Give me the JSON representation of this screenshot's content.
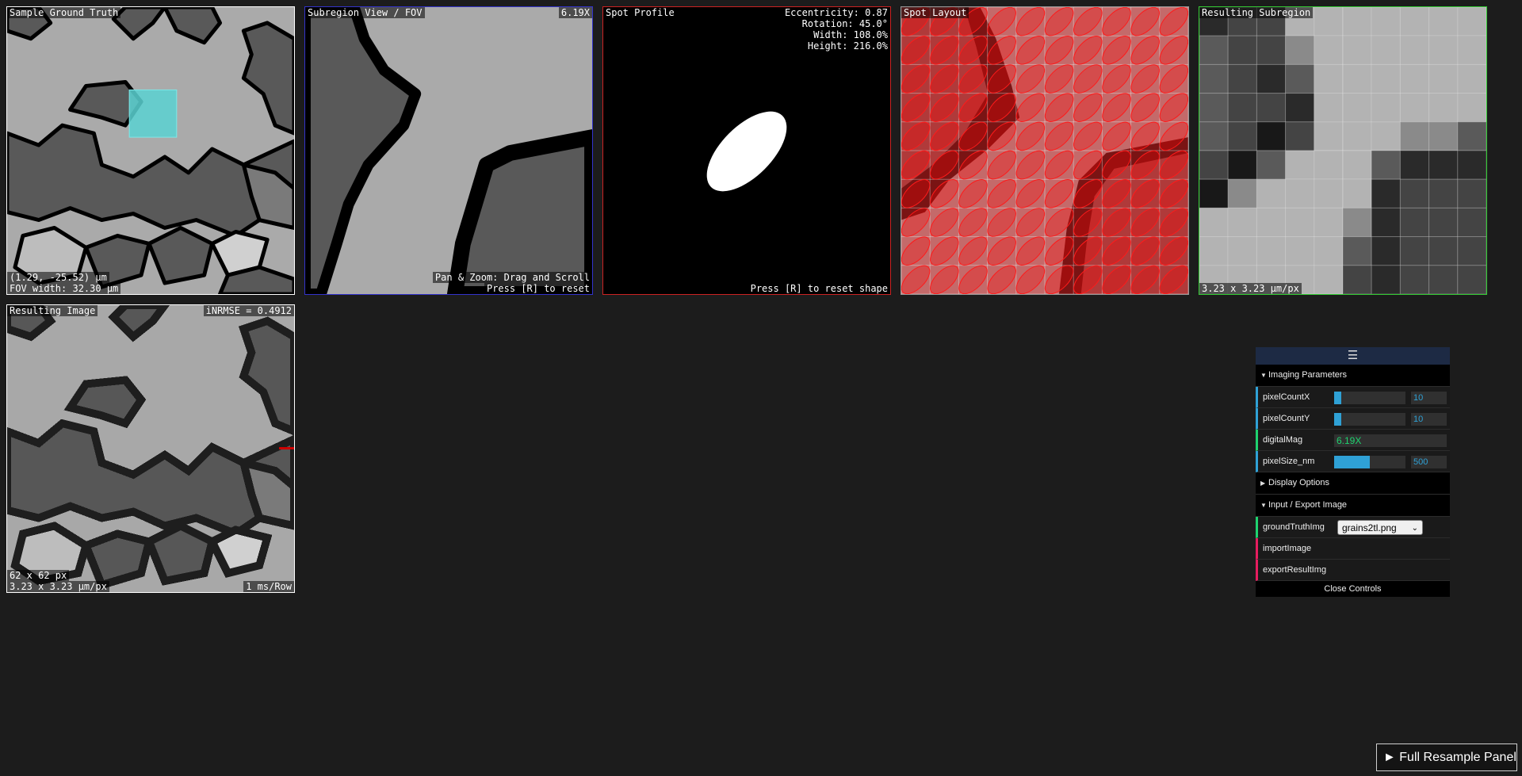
{
  "panels": {
    "ground_truth": {
      "title": "Sample Ground Truth",
      "coords": "(1.29, -25.52) µm",
      "fov_width": "FOV width: 32.30 µm"
    },
    "subregion": {
      "title": "Subregion View / FOV",
      "magnification": "6.19X",
      "hint_line1": "Pan & Zoom: Drag and Scroll",
      "hint_line2": "Press [R] to reset"
    },
    "spot_profile": {
      "title": "Spot Profile",
      "eccentricity": "Eccentricity: 0.87",
      "rotation": "Rotation: 45.0°",
      "width": "Width: 108.0%",
      "height": "Height: 216.0%",
      "hint": "Press [R] to reset shape"
    },
    "spot_layout": {
      "title": "Spot Layout"
    },
    "resulting_subregion": {
      "title": "Resulting Subregion",
      "pixel_size": "3.23 x 3.23 µm/px"
    },
    "resulting_image": {
      "title": "Resulting Image",
      "inrmse": "iNRMSE = 0.4912",
      "dims": "62 x 62 px",
      "pixel_size": "3.23 x 3.23 µm/px",
      "timing": "1 ms/Row"
    }
  },
  "controls": {
    "menu_icon": "hamburger-icon",
    "imaging_folder": "Imaging Parameters",
    "pixel_count_x": {
      "label": "pixelCountX",
      "value": "10",
      "fraction": 0.1
    },
    "pixel_count_y": {
      "label": "pixelCountY",
      "value": "10",
      "fraction": 0.1
    },
    "digital_mag": {
      "label": "digitalMag",
      "value": "6.19X"
    },
    "pixel_size": {
      "label": "pixelSize_nm",
      "value": "500",
      "fraction": 0.5
    },
    "display_folder": "Display Options",
    "io_folder": "Input / Export Image",
    "ground_truth_img": {
      "label": "groundTruthImg",
      "value": "grains2tl.png"
    },
    "import_image": "importImage",
    "export_result": "exportResultImg",
    "close": "Close Controls"
  },
  "resample_button": "► Full Resample Panel",
  "colors": {
    "grain_light": "#aaaaaa",
    "grain_dark": "#595959",
    "boundary": "#000000",
    "fov_box": "#5ad2d2",
    "subregion_border": "#3333cc",
    "spot_border": "#cc2222",
    "result_border": "#33cc33",
    "gui_accent": "#2fa1d6"
  }
}
